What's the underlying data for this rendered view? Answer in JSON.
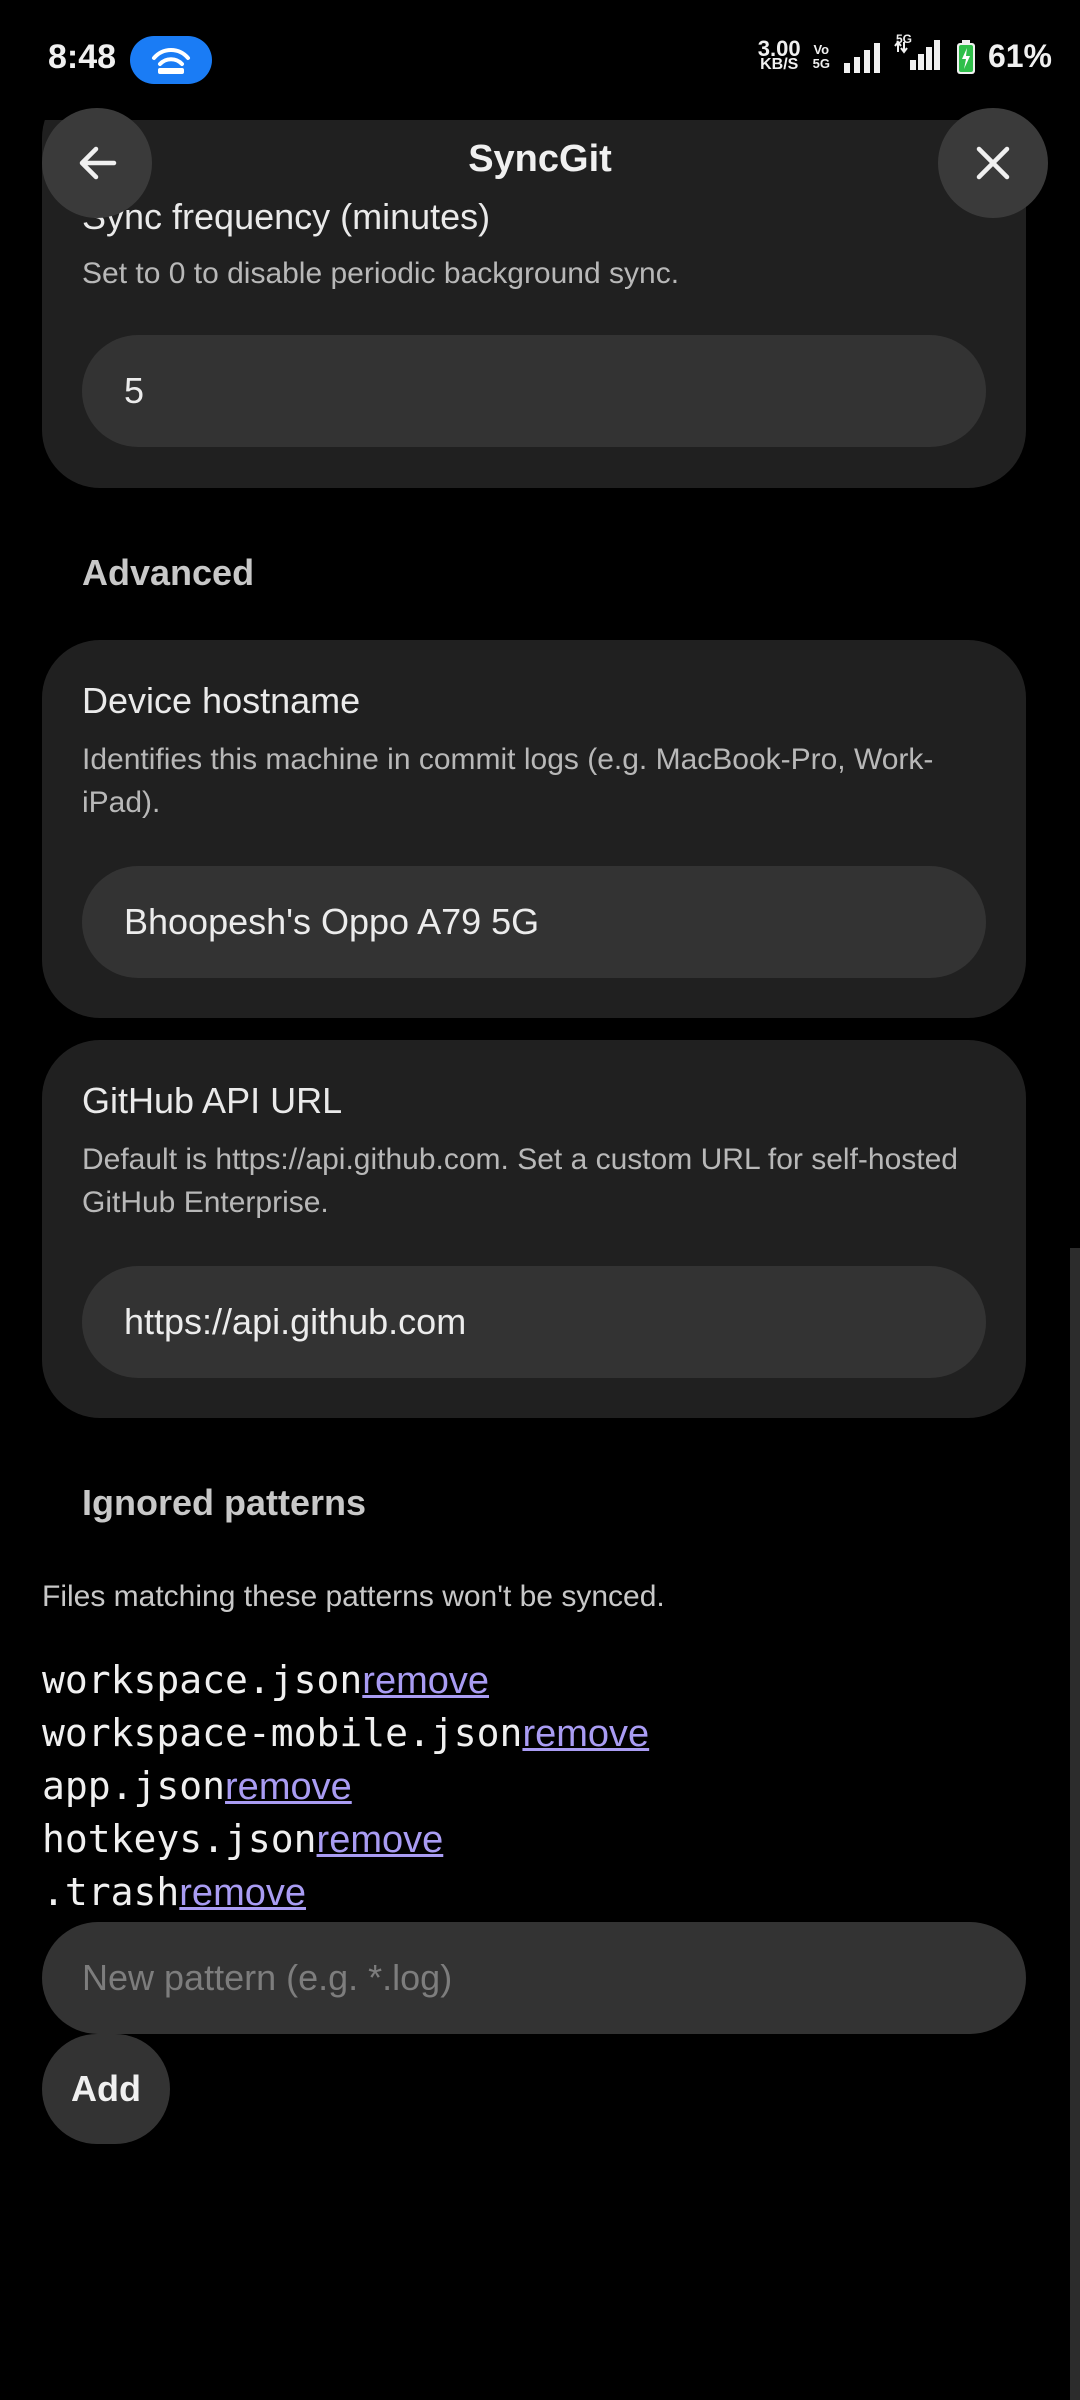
{
  "status_bar": {
    "time": "8:48",
    "net_speed_value": "3.00",
    "net_speed_unit": "KB/S",
    "volte_top": "Vo",
    "volte_bottom": "5G",
    "network_label": "5G",
    "battery": "61%",
    "icons": [
      "hotspot-icon",
      "signal-icon",
      "signal-5g-icon",
      "battery-charging-icon"
    ]
  },
  "header": {
    "title": "SyncGit",
    "back_icon": "arrow-left-icon",
    "close_icon": "close-icon"
  },
  "sync_frequency": {
    "title": "Sync frequency (minutes)",
    "description": "Set to 0 to disable periodic background sync.",
    "value": "5"
  },
  "advanced": {
    "label": "Advanced",
    "hostname": {
      "title": "Device hostname",
      "description": "Identifies this machine in commit logs (e.g. MacBook-Pro, Work-iPad).",
      "value": "Bhoopesh's Oppo A79 5G"
    },
    "api_url": {
      "title": "GitHub API URL",
      "description": "Default is https://api.github.com. Set a custom URL for self-hosted GitHub Enterprise.",
      "value": "https://api.github.com"
    }
  },
  "ignored": {
    "label": "Ignored patterns",
    "description": "Files matching these patterns won't be synced.",
    "remove_label": "remove",
    "patterns": [
      "workspace.json",
      "workspace-mobile.json",
      "app.json",
      "hotkeys.json",
      ".trash"
    ],
    "new_placeholder": "New pattern (e.g. *.log)",
    "add_label": "Add"
  },
  "colors": {
    "background": "#000000",
    "card": "#202020",
    "input": "#333333",
    "link": "#a99cf3",
    "hotspot": "#1a7cf5"
  }
}
